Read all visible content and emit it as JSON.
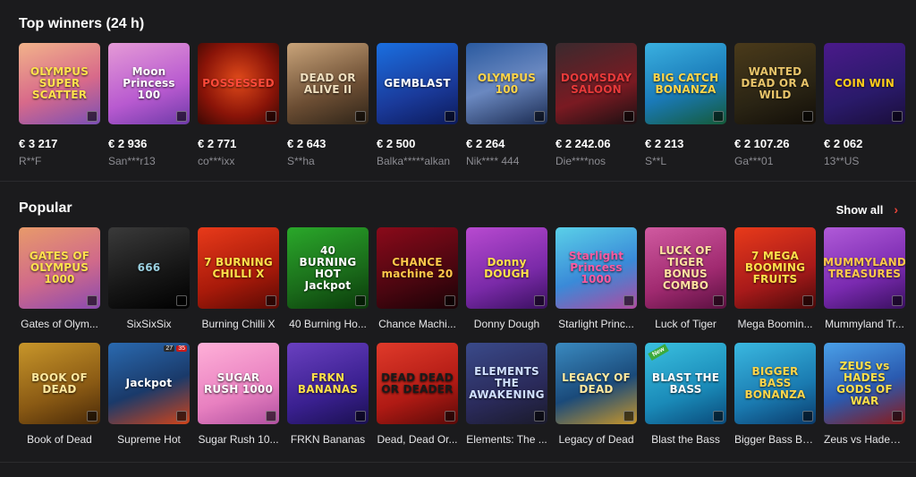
{
  "top_winners": {
    "title": "Top winners (24 h)",
    "items": [
      {
        "tile_text": "OLYMPUS SUPER SCATTER",
        "amount": "€ 3 217",
        "player": "R**F",
        "bg": "linear-gradient(160deg,#f2b38a,#d86a8a 55%,#7a4fb5)",
        "fg": "#ffe24d"
      },
      {
        "tile_text": "Moon Princess 100",
        "amount": "€ 2 936",
        "player": "San***r13",
        "bg": "linear-gradient(160deg,#e59ad6,#b85ad0 60%,#6e3aa8)",
        "fg": "#ffffff"
      },
      {
        "tile_text": "POSSESSED",
        "amount": "€ 2 771",
        "player": "co***ixx",
        "bg": "radial-gradient(circle at 50% 45%,#e04a1a,#8a1408 60%,#3a0804)",
        "fg": "#ff4a3a"
      },
      {
        "tile_text": "DEAD OR ALIVE II",
        "amount": "€ 2 643",
        "player": "S**ha",
        "bg": "linear-gradient(160deg,#c9a47a,#6b4d33 60%,#2e2418)",
        "fg": "#f0e0c0"
      },
      {
        "tile_text": "GEMBLAST",
        "amount": "€ 2 500",
        "player": "Balka*****alkan",
        "bg": "linear-gradient(160deg,#1a6fe0,#1a3a9a 60%,#0c1a5a)",
        "fg": "#ffffff"
      },
      {
        "tile_text": "OLYMPUS 100",
        "amount": "€ 2 264",
        "player": "Nik**** 444",
        "bg": "linear-gradient(160deg,#2a5aa0,#6a88c0 50%,#1a2a50)",
        "fg": "#ffd54a"
      },
      {
        "tile_text": "DOOMSDAY SALOON",
        "amount": "€ 2 242.06",
        "player": "Die****nos",
        "bg": "linear-gradient(160deg,#3a2a2e,#7a1a22 60%,#1a1012)",
        "fg": "#e83a3a"
      },
      {
        "tile_text": "BIG CATCH BONANZA",
        "amount": "€ 2 213",
        "player": "S**L",
        "bg": "linear-gradient(160deg,#3ab0e0,#1a7ab8 55%,#145a38)",
        "fg": "#ffd54a"
      },
      {
        "tile_text": "WANTED DEAD OR A WILD",
        "amount": "€ 2 107.26",
        "player": "Ga***01",
        "bg": "linear-gradient(160deg,#4a3a1a,#2a2414 60%,#120e08)",
        "fg": "#e8c46a"
      },
      {
        "tile_text": "COIN WIN",
        "amount": "€ 2 062",
        "player": "13**US",
        "bg": "linear-gradient(160deg,#4a1a8a,#2a1a6a 60%,#1a0e3a)",
        "fg": "#ffcc1a"
      }
    ]
  },
  "popular": {
    "title": "Popular",
    "show_all_label": "Show all",
    "rows": [
      [
        {
          "name": "Gates of Olym...",
          "tile_text": "GATES OF OLYMPUS 1000",
          "bg": "linear-gradient(160deg,#e89a6a,#d06a8a 55%,#8a4ab0)",
          "fg": "#ffe24d"
        },
        {
          "name": "SixSixSix",
          "tile_text": "666",
          "bg": "linear-gradient(160deg,#3a3a3a,#151515 60%,#000000)",
          "fg": "#9ad0e0"
        },
        {
          "name": "Burning Chilli X",
          "tile_text": "7 BURNING CHILLI X",
          "bg": "linear-gradient(160deg,#e83a1a,#a81a0a 60%,#5a0a04)",
          "fg": "#ffe04a"
        },
        {
          "name": "40 Burning Ho...",
          "tile_text": "40 BURNING HOT Jackpot",
          "bg": "linear-gradient(160deg,#2aa82a,#1a6a1a 60%,#0a3a0a)",
          "fg": "#ffffff"
        },
        {
          "name": "Chance Machi...",
          "tile_text": "CHANCE machine 20",
          "bg": "linear-gradient(160deg,#8a0a1a,#4a0610 60%,#1a0206)",
          "fg": "#ffc94a"
        },
        {
          "name": "Donny Dough",
          "tile_text": "Donny DOUGH",
          "bg": "linear-gradient(160deg,#b84ad0,#7a2aa8 60%,#3a1060)",
          "fg": "#ffe04a"
        },
        {
          "name": "Starlight Princ...",
          "tile_text": "Starlight Princess 1000",
          "bg": "linear-gradient(160deg,#5ad0e8,#3a8ad8 55%,#b04aa0)",
          "fg": "#ff5aa0"
        },
        {
          "name": "Luck of Tiger",
          "tile_text": "LUCK OF TIGER BONUS COMBO",
          "bg": "linear-gradient(160deg,#d05aa0,#a02a70 60%,#5a1040)",
          "fg": "#ffe0a0"
        },
        {
          "name": "Mega Boomin...",
          "tile_text": "7 MEGA BOOMING FRUITS",
          "bg": "linear-gradient(160deg,#e83a1a,#a81a1a 60%,#4a0a0a)",
          "fg": "#ffe04a"
        },
        {
          "name": "Mummyland Tr...",
          "tile_text": "MUMMYLAND TREASURES",
          "bg": "linear-gradient(160deg,#b05ad8,#7a2ab0 60%,#3a1060)",
          "fg": "#ffc94a"
        }
      ],
      [
        {
          "name": "Book of Dead",
          "tile_text": "BOOK OF DEAD",
          "bg": "linear-gradient(160deg,#c8962a,#8a5a14 60%,#4a2a08)",
          "fg": "#ffe9a0"
        },
        {
          "name": "Supreme Hot",
          "tile_text": "Jackpot",
          "bg": "linear-gradient(160deg,#2a6ab0,#1a3a6a 55%,#d0441a)",
          "fg": "#ffffff"
        },
        {
          "name": "Sugar Rush 10...",
          "tile_text": "SUGAR RUSH 1000",
          "bg": "linear-gradient(160deg,#ffb0d8,#e880c0 60%,#b050a0)",
          "fg": "#ffffff"
        },
        {
          "name": "FRKN Bananas",
          "tile_text": "FRKN BANANAS",
          "bg": "linear-gradient(160deg,#6a40c0,#3a2090 60%,#1a1050)",
          "fg": "#ffe04a"
        },
        {
          "name": "Dead, Dead Or...",
          "tile_text": "DEAD DEAD OR DEADER",
          "bg": "linear-gradient(160deg,#e03a2a,#b01a14 60%,#5a0a08)",
          "fg": "#1a1a1a"
        },
        {
          "name": "Elements: The ...",
          "tile_text": "ELEMENTS THE AWAKENING",
          "bg": "linear-gradient(160deg,#3a4a8a,#2a2a5a 60%,#1a1a2a)",
          "fg": "#d0e0ff"
        },
        {
          "name": "Legacy of Dead",
          "tile_text": "LEGACY OF DEAD",
          "bg": "linear-gradient(160deg,#3a8ac0,#1a4a7a 55%,#c8962a)",
          "fg": "#ffe9a0"
        },
        {
          "name": "Blast the Bass",
          "tile_text": "BLAST THE BASS",
          "bg": "linear-gradient(160deg,#3ac0e0,#1a8ab8 60%,#0a4a7a)",
          "fg": "#ffffff",
          "badge_new": "New"
        },
        {
          "name": "Bigger Bass Bo...",
          "tile_text": "BIGGER BASS BONANZA",
          "bg": "linear-gradient(160deg,#3ab8e0,#1a7ab0 60%,#0a3a6a)",
          "fg": "#ffd54a"
        },
        {
          "name": "Zeus vs Hades ...",
          "tile_text": "ZEUS vs HADES GODS OF WAR",
          "bg": "linear-gradient(160deg,#4aa0e8,#2a5ab0 55%,#8a1a1a)",
          "fg": "#ffe04a"
        }
      ]
    ],
    "supreme_hot_badges": [
      "27",
      "35"
    ]
  }
}
